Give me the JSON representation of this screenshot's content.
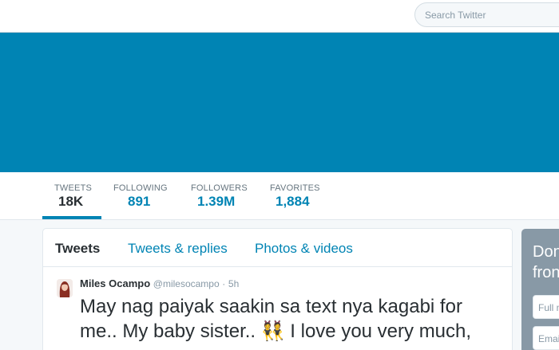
{
  "search": {
    "placeholder": "Search Twitter"
  },
  "colors": {
    "accent": "#0084b4",
    "banner": "#0084b4",
    "page_bg": "#f5f8fa",
    "sidebar_card": "#8899a6"
  },
  "stats": [
    {
      "label": "TWEETS",
      "value": "18K",
      "active": true
    },
    {
      "label": "FOLLOWING",
      "value": "891"
    },
    {
      "label": "FOLLOWERS",
      "value": "1.39M"
    },
    {
      "label": "FAVORITES",
      "value": "1,884"
    }
  ],
  "timeline": {
    "tabs": [
      {
        "label": "Tweets",
        "active": true
      },
      {
        "label": "Tweets & replies"
      },
      {
        "label": "Photos & videos"
      }
    ]
  },
  "tweet": {
    "name": "Miles Ocampo",
    "handle": "@milesocampo",
    "separator": "·",
    "time": "5h",
    "line1": "May nag paiyak saakin sa text nya kagabi for",
    "line2": "me.. My baby sister.. 👯 I love you very much,"
  },
  "sidebar": {
    "heading_line1": "Don",
    "heading_line2": "fron",
    "input1_placeholder": "Full n",
    "input2_placeholder": "Emai"
  }
}
